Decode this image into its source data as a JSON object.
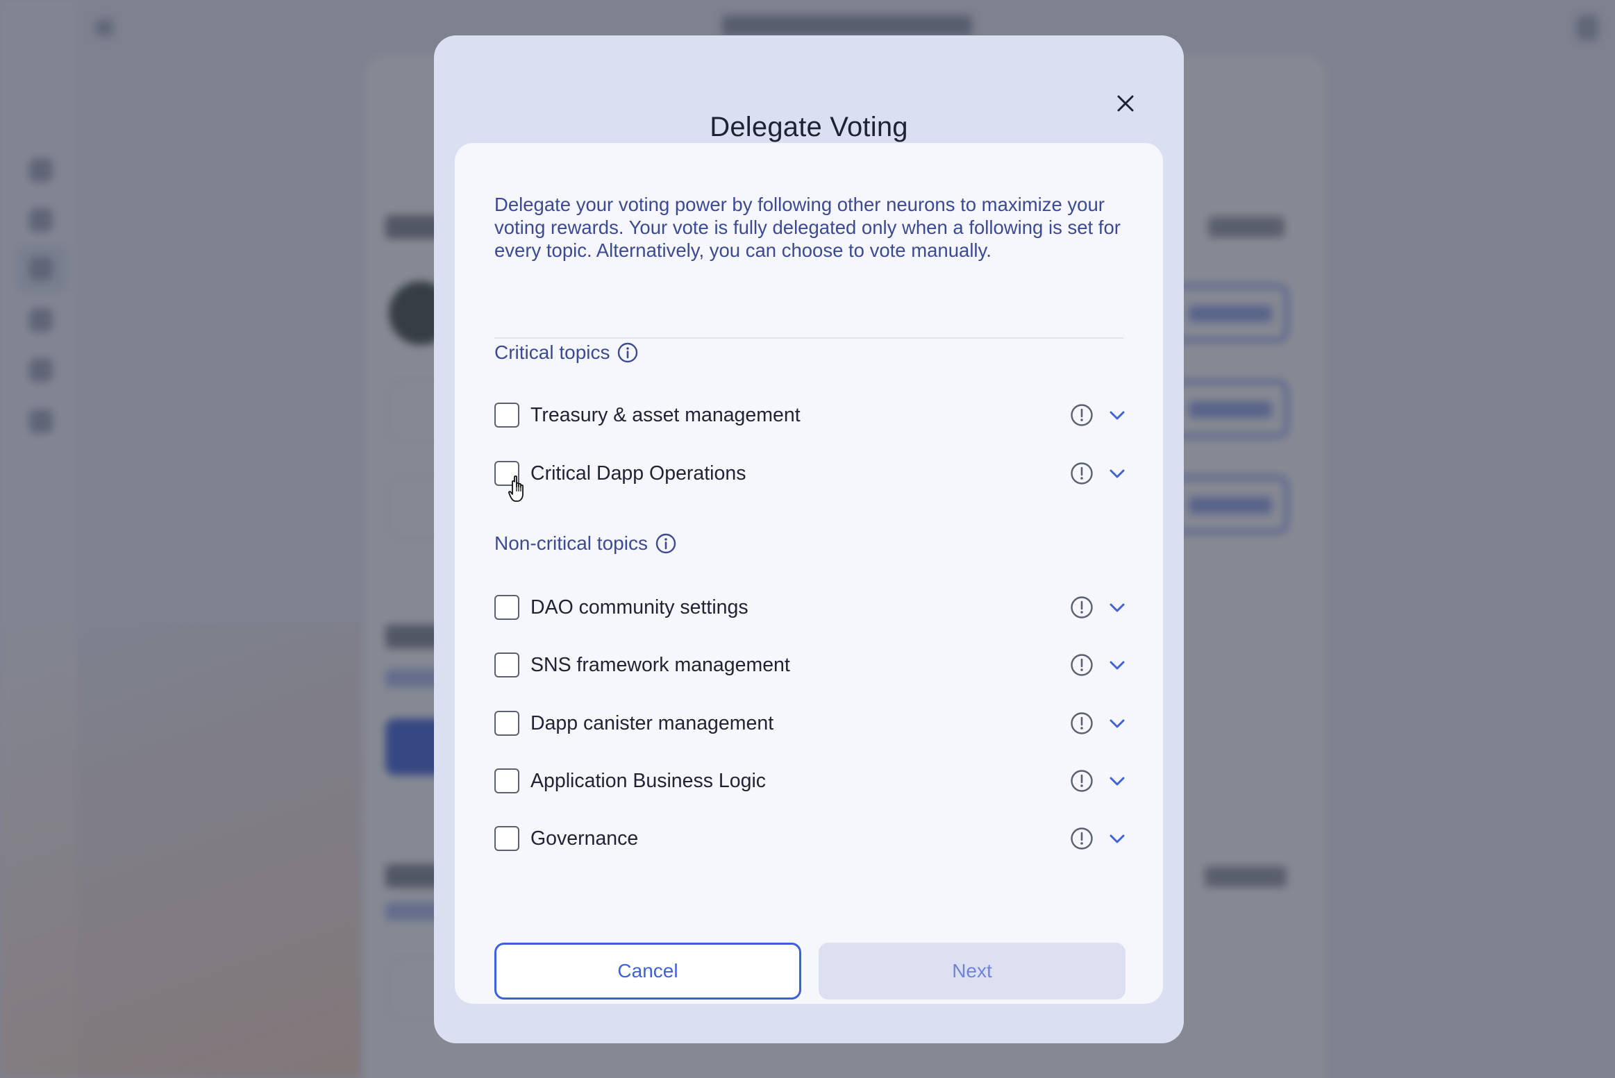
{
  "modal": {
    "title": "Delegate Voting",
    "intro": "Delegate your voting power by following other neurons to maximize your voting rewards. Your vote is fully delegated only when a following is set for every topic. Alternatively, you can choose to vote manually.",
    "critical_title": "Critical topics",
    "noncritical_title": "Non-critical topics",
    "critical_topics": [
      {
        "label": "Treasury & asset management",
        "checked": false
      },
      {
        "label": "Critical Dapp Operations",
        "checked": false
      }
    ],
    "noncritical_topics": [
      {
        "label": "DAO community settings",
        "checked": false
      },
      {
        "label": "SNS framework management",
        "checked": false
      },
      {
        "label": "Dapp canister management",
        "checked": false
      },
      {
        "label": "Application Business Logic",
        "checked": false
      },
      {
        "label": "Governance",
        "checked": false
      }
    ],
    "cancel_label": "Cancel",
    "next_label": "Next"
  },
  "colors": {
    "accent": "#3b62d8",
    "text_blue": "#3c4a94",
    "modal_bg": "#dadff1",
    "inner_bg": "#f6f6fd"
  },
  "icons": [
    "close-icon",
    "info-icon",
    "warning-circle-icon",
    "chevron-down-icon",
    "hand-pointer-cursor"
  ]
}
